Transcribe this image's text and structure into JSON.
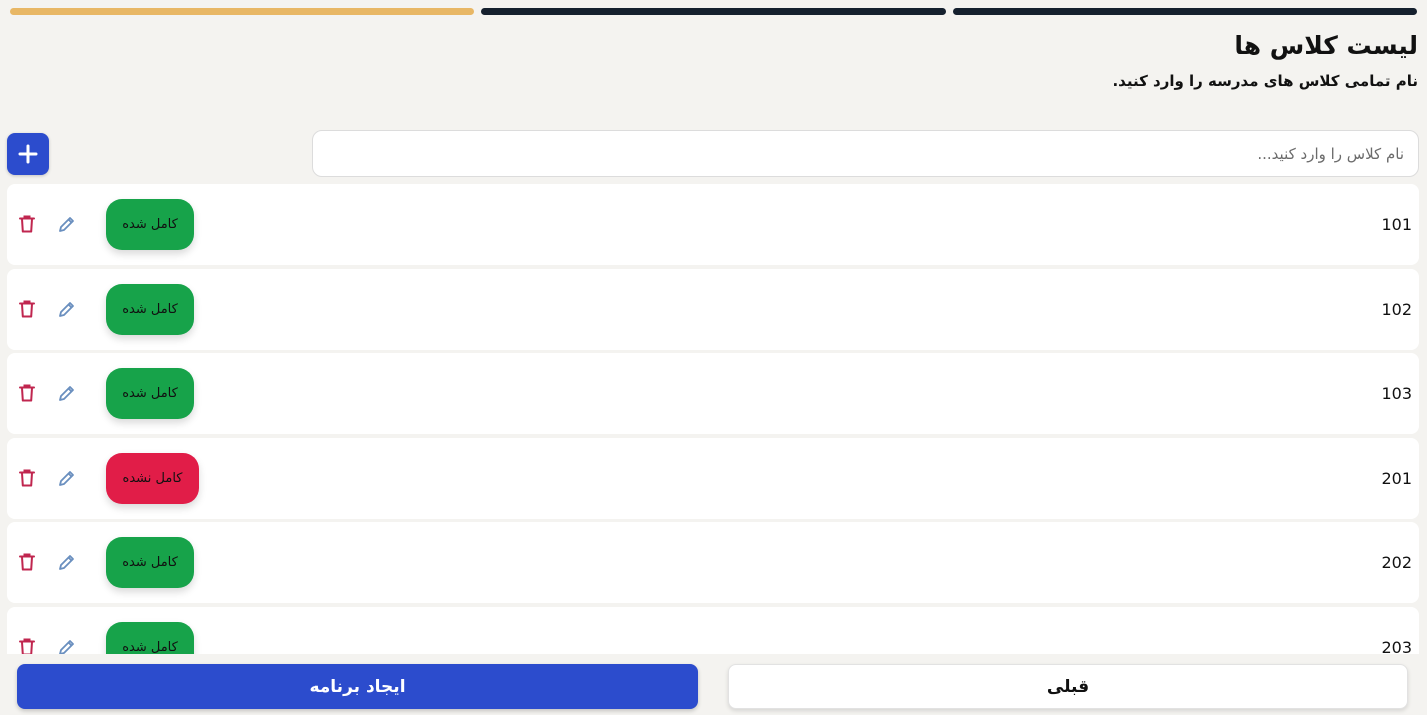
{
  "stepper": {
    "steps": [
      {
        "state": "active"
      },
      {
        "state": "complete"
      },
      {
        "state": "complete"
      }
    ],
    "colors": {
      "active": "#e8b765",
      "complete": "#15202e"
    }
  },
  "header": {
    "title": "لیست کلاس ها",
    "subtitle": "نام تمامی کلاس های مدرسه را وارد کنید."
  },
  "search": {
    "placeholder": "نام کلاس را وارد کنید...",
    "value": ""
  },
  "add_button": {
    "icon": "plus-icon",
    "color": "#2c4ccd"
  },
  "classes": [
    {
      "name": "101",
      "status": "کامل شده",
      "state": "done"
    },
    {
      "name": "102",
      "status": "کامل شده",
      "state": "done"
    },
    {
      "name": "103",
      "status": "کامل شده",
      "state": "done"
    },
    {
      "name": "201",
      "status": "کامل نشده",
      "state": "notdone"
    },
    {
      "name": "202",
      "status": "کامل شده",
      "state": "done"
    },
    {
      "name": "203",
      "status": "کامل شده",
      "state": "done"
    }
  ],
  "row_icons": {
    "delete": "trash-icon",
    "edit": "pencil-icon"
  },
  "colors": {
    "done": "#17a34a",
    "notdone": "#e11d48",
    "delete": "#c0264f",
    "edit": "#6a8fbf",
    "primary": "#2c4ccd"
  },
  "footer": {
    "create_label": "ایجاد برنامه",
    "prev_label": "قبلی"
  }
}
